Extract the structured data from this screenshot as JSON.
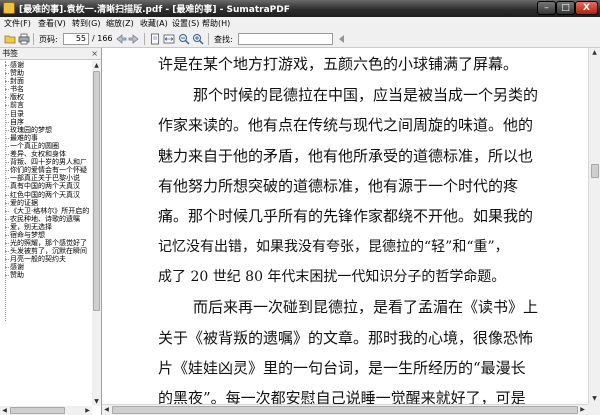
{
  "window": {
    "title": "[最难的事].袁枚一.清晰扫描版.pdf - [最难的事] - SumatraPDF",
    "min_label": "–",
    "max_label": "□",
    "close_label": "X"
  },
  "menu": [
    "文件(F)",
    "查看(V)",
    "转到(G)",
    "缩放(Z)",
    "收藏(A)",
    "设置(S)",
    "帮助(H)"
  ],
  "toolbar": {
    "page_label": "页码:",
    "page_value": "55",
    "page_total": "/ 166",
    "find_label": "查找:",
    "find_value": ""
  },
  "sidebar": {
    "header": "书签",
    "close_label": "×",
    "items": [
      "感谢",
      "赞助",
      "封面",
      "书名",
      "版权",
      "前言",
      "目录",
      "自序",
      "玫瑰园的梦想",
      "最难的事",
      "一个真正的圆圈",
      "差异、女权和身体",
      "背叛、四十岁的男人和ㄏ",
      "你们的爱情会有一个怀疑",
      "一部真正关于巴黎小说",
      "真有中国的两个天真汉",
      "红色中国的两个天真汉",
      "爱的证据",
      "《大卫·格林尔》所开启的",
      "农民种地、诗歌的遗嘱",
      "爱，别无选择",
      "宿命与梦想",
      "光的照耀，那个感觉好了",
      "头发被剪了，沉默在瞬间",
      "月亮一般的契约夫",
      "感谢",
      "赞助"
    ]
  },
  "document": {
    "lines": [
      "许是在某个地方打游戏，五颜六色的小球铺满了屏幕。",
      "那个时候的昆德拉在中国，应当是被当成一个另类的",
      "作家来读的。他有点在传统与现代之间周旋的味道。他的",
      "魅力来自于他的矛盾，他有他所承受的道德标准，所以也",
      "有他努力所想突破的道德标准，他有源于一个时代的疼",
      "痛。那个时候几乎所有的先锋作家都绕不开他。如果我的",
      "记忆没有出错，如果我没有夸张，昆德拉的“轻”和“重”，",
      "成了 20 世纪 80 年代末困扰一代知识分子的哲学命题。",
      "而后来再一次碰到昆德拉，是看了孟湄在《读书》上",
      "关于《被背叛的遗嘱》的文章。那时我的心境，很像恐怖",
      "片《娃娃凶灵》里的一句台词，是一生所经历的“最漫长",
      "的黑夜”。每一次都安慰自己说睡一觉醒来就好了，可是"
    ]
  },
  "colors": {
    "titlebar": "#2e2e2e",
    "menubar": "#f0f0f0",
    "document_bg": "#ffffff",
    "text": "#111111"
  }
}
